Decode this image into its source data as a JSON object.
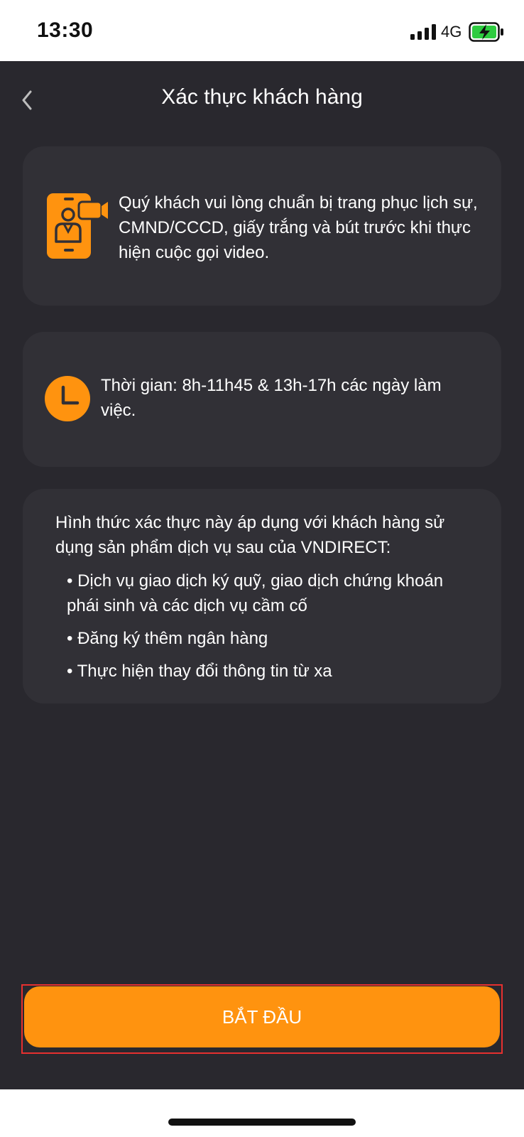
{
  "status_bar": {
    "time": "13:30",
    "network": "4G",
    "icons": [
      "signal-icon",
      "battery-charging-icon"
    ]
  },
  "header": {
    "back_icon": "chevron-left-icon",
    "title": "Xác thực khách hàng"
  },
  "cards": {
    "preparation": {
      "icon": "video-call-icon",
      "text": "Quý khách vui lòng chuẩn bị trang phục lịch sự, CMND/CCCD, giấy trắng và bút trước khi thực hiện cuộc gọi video."
    },
    "hours": {
      "icon": "clock-icon",
      "text": "Thời gian: 8h-11h45 & 13h-17h các ngày làm việc."
    },
    "scope": {
      "intro": "Hình thức xác thực này áp dụng với khách hàng sử dụng sản phẩm dịch vụ sau của VNDIRECT:",
      "items": [
        "Dịch vụ giao dịch ký quỹ, giao dịch chứng khoán phái sinh và các dịch vụ cầm cố",
        "Đăng ký thêm ngân hàng",
        "Thực hiện thay đổi thông tin từ xa"
      ]
    }
  },
  "actions": {
    "start_label": "BẮT ĐẦU"
  },
  "colors": {
    "accent": "#ff930f",
    "background": "#29282e",
    "card": "#313036",
    "highlight": "#e6302f"
  }
}
